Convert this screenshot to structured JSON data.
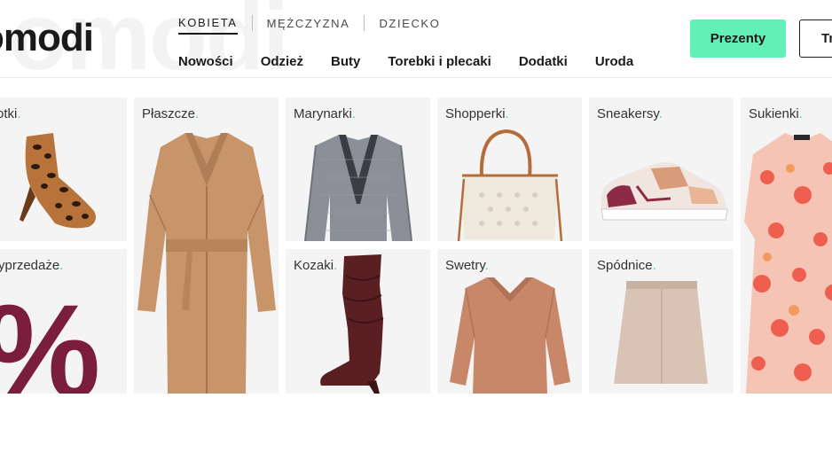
{
  "header": {
    "logo": "omodi",
    "gender_tabs": [
      {
        "label": "KOBIETA",
        "active": true
      },
      {
        "label": "MĘŻCZYZNA",
        "active": false
      },
      {
        "label": "DZIECKO",
        "active": false
      }
    ],
    "categories": [
      "Nowości",
      "Odzież",
      "Buty",
      "Torebki i plecaki",
      "Dodatki",
      "Uroda"
    ],
    "gifts_button": "Prezenty",
    "outline_button": "Tr"
  },
  "tiles": {
    "botki": "otki",
    "wyprzedaze": "yprzedaże",
    "wyprzedaze_symbol": "%",
    "plaszcze": "Płaszcze",
    "marynarki": "Marynarki",
    "kozaki": "Kozaki",
    "shopperki": "Shopperki",
    "swetry": "Swetry",
    "sneakersy": "Sneakersy",
    "spodnice": "Spódnice",
    "sukienki": "Sukienki",
    "label_dot": "."
  },
  "colors": {
    "accent": "#63f0b6",
    "dot": "#3fd49a",
    "sale": "#7b1d3c",
    "tile_bg": "#f4f4f4"
  }
}
